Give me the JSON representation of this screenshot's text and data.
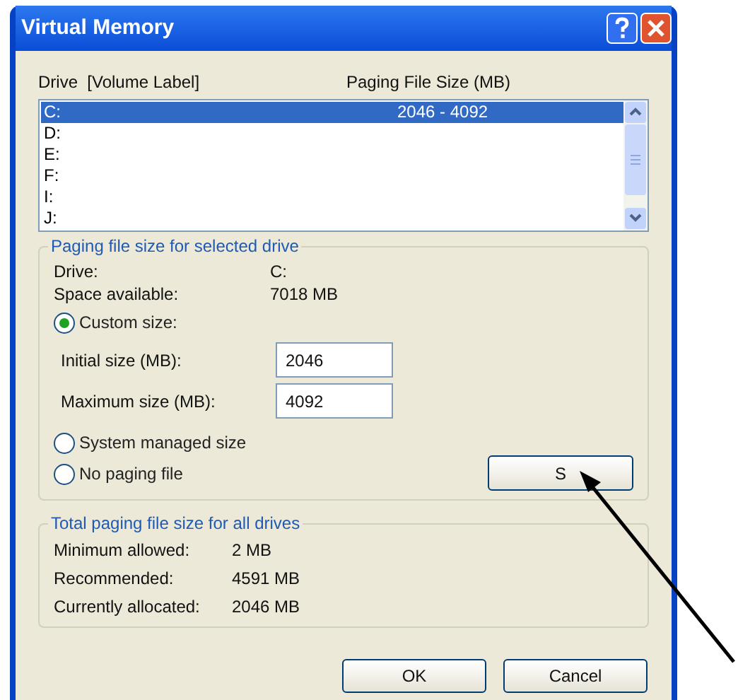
{
  "window": {
    "title": "Virtual Memory"
  },
  "drive_list": {
    "columns": [
      "Drive  [Volume Label]",
      "Paging File Size (MB)"
    ],
    "rows": [
      {
        "drive": "C:",
        "size": "2046 - 4092",
        "selected": true
      },
      {
        "drive": "D:",
        "selected": false
      },
      {
        "drive": "E:",
        "selected": false
      },
      {
        "drive": "F:",
        "selected": false
      },
      {
        "drive": "I:",
        "selected": false
      },
      {
        "drive": "J:",
        "selected": false
      }
    ]
  },
  "selected_drive_group": {
    "title": "Paging file size for selected drive",
    "info": [
      {
        "label": "Drive:",
        "value": "C:"
      },
      {
        "label": "Space available:",
        "value": "7018 MB"
      }
    ],
    "custom_option": {
      "label": "Custom size:",
      "selected": true
    },
    "fields": [
      {
        "label": "Initial size (MB):",
        "value": "2046"
      },
      {
        "label": "Maximum size (MB):",
        "value": "4092"
      }
    ],
    "other_options": [
      {
        "label": "System managed size",
        "selected": false
      },
      {
        "label": "No paging file",
        "selected": false
      }
    ],
    "set_button": "S"
  },
  "totals_group": {
    "title": "Total paging file size for all drives",
    "rows": [
      {
        "label": "Minimum allowed:",
        "value": "2 MB"
      },
      {
        "label": "Recommended:",
        "value": "4591 MB"
      },
      {
        "label": "Currently allocated:",
        "value": "2046 MB"
      }
    ]
  },
  "buttons": [
    "OK",
    "Cancel"
  ]
}
